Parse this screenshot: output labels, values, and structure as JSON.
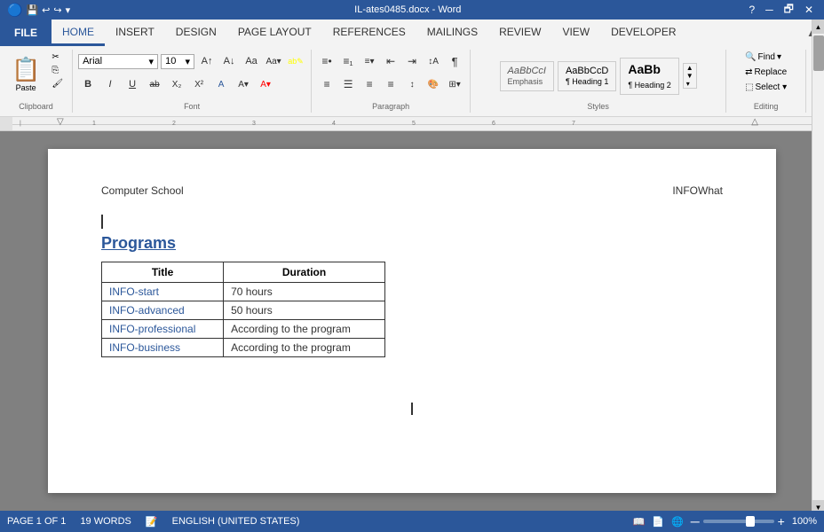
{
  "titlebar": {
    "filename": "IL-ates0485.docx - Word",
    "help_icon": "?",
    "restore_icon": "🗗",
    "minimize_icon": "─",
    "maximize_icon": "□",
    "close_icon": "✕"
  },
  "ribbon": {
    "tabs": [
      {
        "id": "file",
        "label": "FILE",
        "active": false,
        "is_file": true
      },
      {
        "id": "home",
        "label": "HOME",
        "active": true
      },
      {
        "id": "insert",
        "label": "INSERT",
        "active": false
      },
      {
        "id": "design",
        "label": "DESIGN",
        "active": false
      },
      {
        "id": "page_layout",
        "label": "PAGE LAYOUT",
        "active": false
      },
      {
        "id": "references",
        "label": "REFERENCES",
        "active": false
      },
      {
        "id": "mailings",
        "label": "MAILINGS",
        "active": false
      },
      {
        "id": "review",
        "label": "REVIEW",
        "active": false
      },
      {
        "id": "view",
        "label": "VIEW",
        "active": false
      },
      {
        "id": "developer",
        "label": "DEVELOPER",
        "active": false
      }
    ],
    "groups": {
      "clipboard": {
        "label": "Clipboard",
        "paste_label": "Paste"
      },
      "font": {
        "label": "Font",
        "font_name": "Arial",
        "font_size": "10",
        "expand_label": "Font"
      },
      "paragraph": {
        "label": "Paragraph",
        "expand_label": "Paragraph"
      },
      "styles": {
        "label": "Styles",
        "items": [
          {
            "id": "emphasis",
            "label": "AaBbCcI",
            "name": "Emphasis",
            "style": "italic"
          },
          {
            "id": "heading1",
            "label": "AaBbCcD",
            "name": "Heading 1"
          },
          {
            "id": "heading2",
            "label": "AaBb",
            "name": "Heading 2",
            "large": true
          }
        ]
      },
      "editing": {
        "label": "Editing",
        "find_label": "Find",
        "replace_label": "Replace",
        "select_label": "Select ▾"
      }
    }
  },
  "document": {
    "header_left": "Computer School",
    "header_right": "INFOWhat",
    "programs_title": "Programs",
    "table": {
      "headers": [
        "Title",
        "Duration"
      ],
      "rows": [
        {
          "title": "INFO-start",
          "duration": "70 hours"
        },
        {
          "title": "INFO-advanced",
          "duration": "50 hours"
        },
        {
          "title": "INFO-professional",
          "duration": "According to the program"
        },
        {
          "title": "INFO-business",
          "duration": "According to the program"
        }
      ]
    }
  },
  "statusbar": {
    "page_info": "PAGE 1 OF 1",
    "word_count": "19 WORDS",
    "language": "ENGLISH (UNITED STATES)",
    "zoom_percent": "100%",
    "zoom_minus": "─",
    "zoom_plus": "+"
  }
}
